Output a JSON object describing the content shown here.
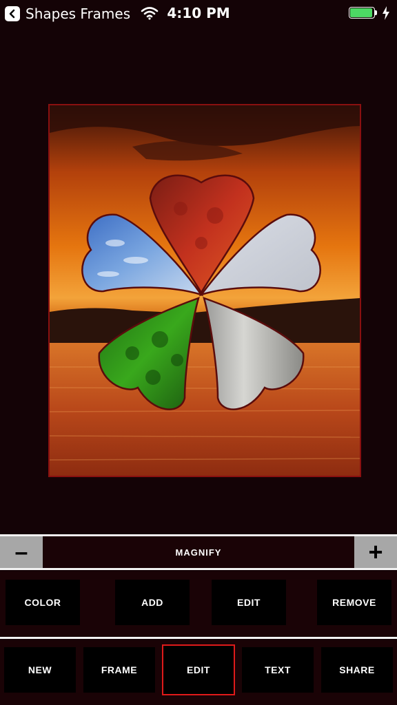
{
  "status_bar": {
    "back_app_label": "Shapes Frames",
    "time": "4:10 PM",
    "icons": [
      "back-arrow-icon",
      "wifi-icon",
      "battery-icon",
      "charging-bolt-icon"
    ],
    "battery_color": "#4cd964"
  },
  "magnify": {
    "minus_label": "–",
    "label": "MAGNIFY",
    "plus_label": "+"
  },
  "toolbar_top": {
    "color_label": "COLOR",
    "add_label": "ADD",
    "edit_label": "EDIT",
    "remove_label": "REMOVE"
  },
  "toolbar_bottom": {
    "new_label": "NEW",
    "frame_label": "FRAME",
    "edit_label": "EDIT",
    "text_label": "TEXT",
    "share_label": "SHARE",
    "active": "EDIT"
  },
  "colors": {
    "background": "#140306",
    "active_border": "#e01a1a",
    "magnify_buttons": "#a7a7a7"
  }
}
